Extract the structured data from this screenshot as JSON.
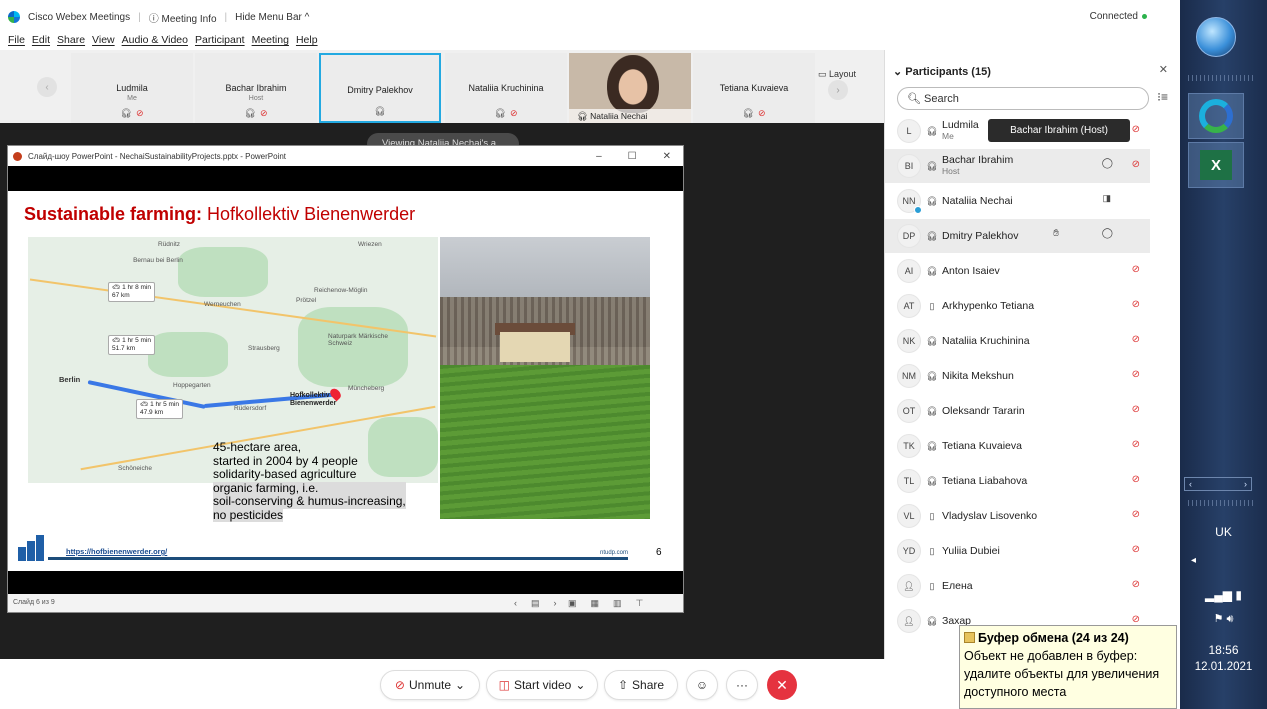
{
  "window": {
    "app_name": "Cisco Webex Meetings",
    "meeting_info": "Meeting Info",
    "hide_menu_bar": "Hide Menu Bar ^",
    "connection_status": "Connected",
    "controls": {
      "minimize": "–",
      "restore": "❐",
      "close": "✕"
    }
  },
  "menu": [
    "File",
    "Edit",
    "Share",
    "View",
    "Audio & Video",
    "Participant",
    "Meeting",
    "Help"
  ],
  "strip": {
    "tiles": [
      {
        "name": "Ludmila",
        "role": "Me",
        "muted": true
      },
      {
        "name": "Bachar Ibrahim",
        "role": "Host",
        "muted": true
      },
      {
        "name": "Dmitry Palekhov",
        "role": "",
        "muted": false
      },
      {
        "name": "Nataliia Kruchinina",
        "role": "",
        "muted": true
      },
      {
        "name": "Nataliia Nechai",
        "role": "",
        "muted": false
      },
      {
        "name": "Tetiana Kuvaieva",
        "role": "",
        "muted": true
      }
    ],
    "layout_label": "Layout",
    "prev_icon": "chevron-left-icon",
    "next_icon": "chevron-right-icon"
  },
  "stage": {
    "viewing_label": "Viewing Nataliia Nechai's a..."
  },
  "ppt": {
    "window_title": "Слайд-шоу PowerPoint - NechaiSustainabilityProjects.pptx - PowerPoint",
    "status_left": "Слайд 6 из 9",
    "slide": {
      "title_bold": "Sustainable farming:",
      "title_rest": "Hofkollektiv Bienenwerder",
      "text_lines": [
        "45-hectare area,",
        "started in 2004 by 4 people",
        "solidarity-based agriculture",
        "organic farming, i.e.",
        "soil-conserving & humus-increasing,",
        "no pesticides"
      ],
      "link": "https://hofbienenwerder.org/",
      "footer_brand": "ntudp.com",
      "page_number": "6",
      "map": {
        "berlin": "Berlin",
        "place": "Hofkollektiv Bienenwerder",
        "chips": [
          {
            "time": "1 hr 8 min",
            "dist": "67 km"
          },
          {
            "time": "1 hr 5 min",
            "dist": "51.7 km"
          },
          {
            "time": "1 hr 5 min",
            "dist": "47.9 km"
          }
        ],
        "cities": [
          "Rüdnitz",
          "Bernau bei Berlin",
          "Wriezen",
          "Werneuchen",
          "Reichenow-Möglin",
          "Strausberg",
          "Naturpark Märkische Schweiz",
          "Müncheberg",
          "Hoppegarten",
          "Rüdersdorf",
          "Schöneiche",
          "Prötzel"
        ]
      }
    }
  },
  "controls": {
    "unmute": "Unmute",
    "start_video": "Start video",
    "share": "Share",
    "reactions_icon": "smiley-icon",
    "more": "···",
    "end": "✕"
  },
  "panel": {
    "title": "Participants (15)",
    "search_placeholder": "Search",
    "tooltip": "Bachar Ibrahim (Host)",
    "participants": [
      {
        "initials": "L",
        "name": "Ludmila",
        "sub": "Me",
        "device": "headset",
        "muted": true
      },
      {
        "initials": "BI",
        "name": "Bachar Ibrahim",
        "sub": "Host",
        "device": "headset",
        "muted": true,
        "chat": true
      },
      {
        "initials": "NN",
        "name": "Nataliia Nechai",
        "sub": "",
        "device": "headset",
        "muted": false,
        "camera": true
      },
      {
        "initials": "DP",
        "name": "Dmitry Palekhov",
        "sub": "",
        "device": "headset",
        "muted": false,
        "chat": true,
        "hand": true
      },
      {
        "initials": "AI",
        "name": "Anton Isaiev",
        "sub": "",
        "device": "headset",
        "muted": true
      },
      {
        "initials": "AT",
        "name": "Arkhypenko Tetiana",
        "sub": "",
        "device": "phone",
        "muted": true
      },
      {
        "initials": "NK",
        "name": "Nataliia Kruchinina",
        "sub": "",
        "device": "headset",
        "muted": true
      },
      {
        "initials": "NM",
        "name": "Nikita Mekshun",
        "sub": "",
        "device": "headset",
        "muted": true
      },
      {
        "initials": "OT",
        "name": "Oleksandr Tararin",
        "sub": "",
        "device": "headset",
        "muted": true
      },
      {
        "initials": "TK",
        "name": "Tetiana Kuvaieva",
        "sub": "",
        "device": "headset",
        "muted": true
      },
      {
        "initials": "TL",
        "name": "Tetiana Liabahova",
        "sub": "",
        "device": "headset",
        "muted": true
      },
      {
        "initials": "VL",
        "name": "Vladyslav Lisovenko",
        "sub": "",
        "device": "phone",
        "muted": true
      },
      {
        "initials": "YD",
        "name": "Yuliia Dubiei",
        "sub": "",
        "device": "phone",
        "muted": true
      },
      {
        "initials": "",
        "name": "Елена",
        "sub": "",
        "device": "phone",
        "muted": true,
        "person_icon": true
      },
      {
        "initials": "",
        "name": "Захар",
        "sub": "",
        "device": "headset",
        "muted": true,
        "person_icon": true
      }
    ]
  },
  "balloon": {
    "title": "Буфер обмена (24 из 24)",
    "lines": [
      "Объект не добавлен в буфер:",
      "удалите объекты для увеличения",
      "доступного места"
    ]
  },
  "taskbar": {
    "language": "UK",
    "time": "18:56",
    "date": "12.01.2021"
  }
}
